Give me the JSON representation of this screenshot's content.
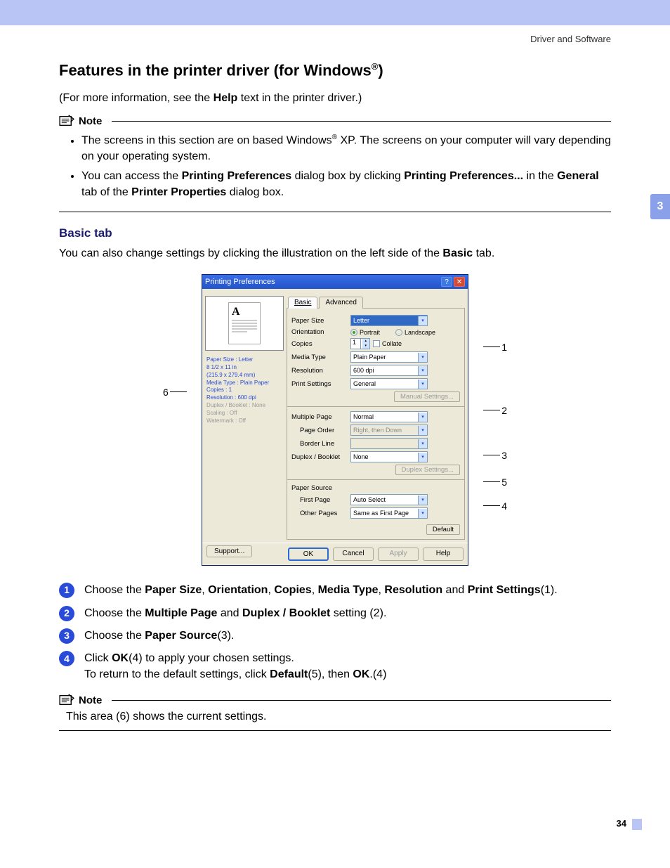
{
  "header": {
    "section": "Driver and Software"
  },
  "chapter_tab": "3",
  "title": {
    "pre": "Features in the printer driver (for Windows",
    "sup": "®",
    "post": ")"
  },
  "intro": {
    "a": "(For more information, see the ",
    "b": "Help",
    "c": " text in the printer driver.)"
  },
  "note1": {
    "label": "Note",
    "item1": {
      "a": "The screens in this section are on based Windows",
      "sup": "®",
      "b": " XP. The screens on your computer will vary depending on your operating system."
    },
    "item2": {
      "a": "You can access the ",
      "b": "Printing Preferences",
      "c": " dialog box by clicking ",
      "d": "Printing Preferences...",
      "e": " in the ",
      "f": "General",
      "g": " tab of the ",
      "h": "Printer Properties",
      "i": " dialog box."
    }
  },
  "h2": "Basic tab",
  "subintro": {
    "a": "You can also change settings by clicking the illustration on the left side of the ",
    "b": "Basic",
    "c": " tab."
  },
  "dialog": {
    "title": "Printing Preferences",
    "tabs": {
      "basic": "Basic",
      "advanced": "Advanced"
    },
    "labels": {
      "paperSize": "Paper Size",
      "orientation": "Orientation",
      "copies": "Copies",
      "mediaType": "Media Type",
      "resolution": "Resolution",
      "printSettings": "Print Settings",
      "multiplePage": "Multiple Page",
      "pageOrder": "Page Order",
      "borderLine": "Border Line",
      "duplex": "Duplex / Booklet",
      "paperSource": "Paper Source",
      "firstPage": "First Page",
      "otherPages": "Other Pages"
    },
    "values": {
      "paperSize": "Letter",
      "portrait": "Portrait",
      "landscape": "Landscape",
      "copies": "1",
      "collate": "Collate",
      "mediaType": "Plain Paper",
      "resolution": "600 dpi",
      "printSettings": "General",
      "manualSettings": "Manual Settings...",
      "multiplePage": "Normal",
      "pageOrder": "Right, then Down",
      "borderLine": "",
      "duplex": "None",
      "duplexSettings": "Duplex Settings...",
      "firstPage": "Auto Select",
      "otherPages": "Same as First Page",
      "default": "Default"
    },
    "footer": {
      "support": "Support...",
      "ok": "OK",
      "cancel": "Cancel",
      "apply": "Apply",
      "help": "Help"
    },
    "status": {
      "l1a": "Paper Size : Letter",
      "l1b": "8 1/2 x 11 in",
      "l1c": "(215.9 x 279.4 mm)",
      "l2": "Media Type : Plain Paper",
      "l3": "Copies : 1",
      "l4": "Resolution : 600 dpi",
      "l5": "Duplex / Booklet : None",
      "l6": "Scaling : Off",
      "l7": "Watermark : Off"
    }
  },
  "callouts": {
    "c1": "1",
    "c2": "2",
    "c3": "3",
    "c4": "4",
    "c5": "5",
    "c6": "6"
  },
  "steps": {
    "s1": {
      "n": "1",
      "a": "Choose the ",
      "b": "Paper Size",
      "c": ", ",
      "d": "Orientation",
      "e": ", ",
      "f": "Copies",
      "g": ", ",
      "h": "Media Type",
      "i": ", ",
      "j": "Resolution",
      "k": " and ",
      "l": "Print Settings",
      "m": "(1)."
    },
    "s2": {
      "n": "2",
      "a": "Choose the ",
      "b": "Multiple Page",
      "c": " and ",
      "d": "Duplex / Booklet",
      "e": " setting (2)."
    },
    "s3": {
      "n": "3",
      "a": "Choose the ",
      "b": "Paper Source",
      "c": "(3)."
    },
    "s4": {
      "n": "4",
      "a": "Click ",
      "b": "OK",
      "c": "(4) to apply your chosen settings.",
      "d": "To return to the default settings, click ",
      "e": "Default",
      "f": "(5), then ",
      "g": "OK",
      "h": ".(4)"
    }
  },
  "note2": {
    "label": "Note",
    "body": "This area (6) shows the current settings."
  },
  "page_num": "34"
}
